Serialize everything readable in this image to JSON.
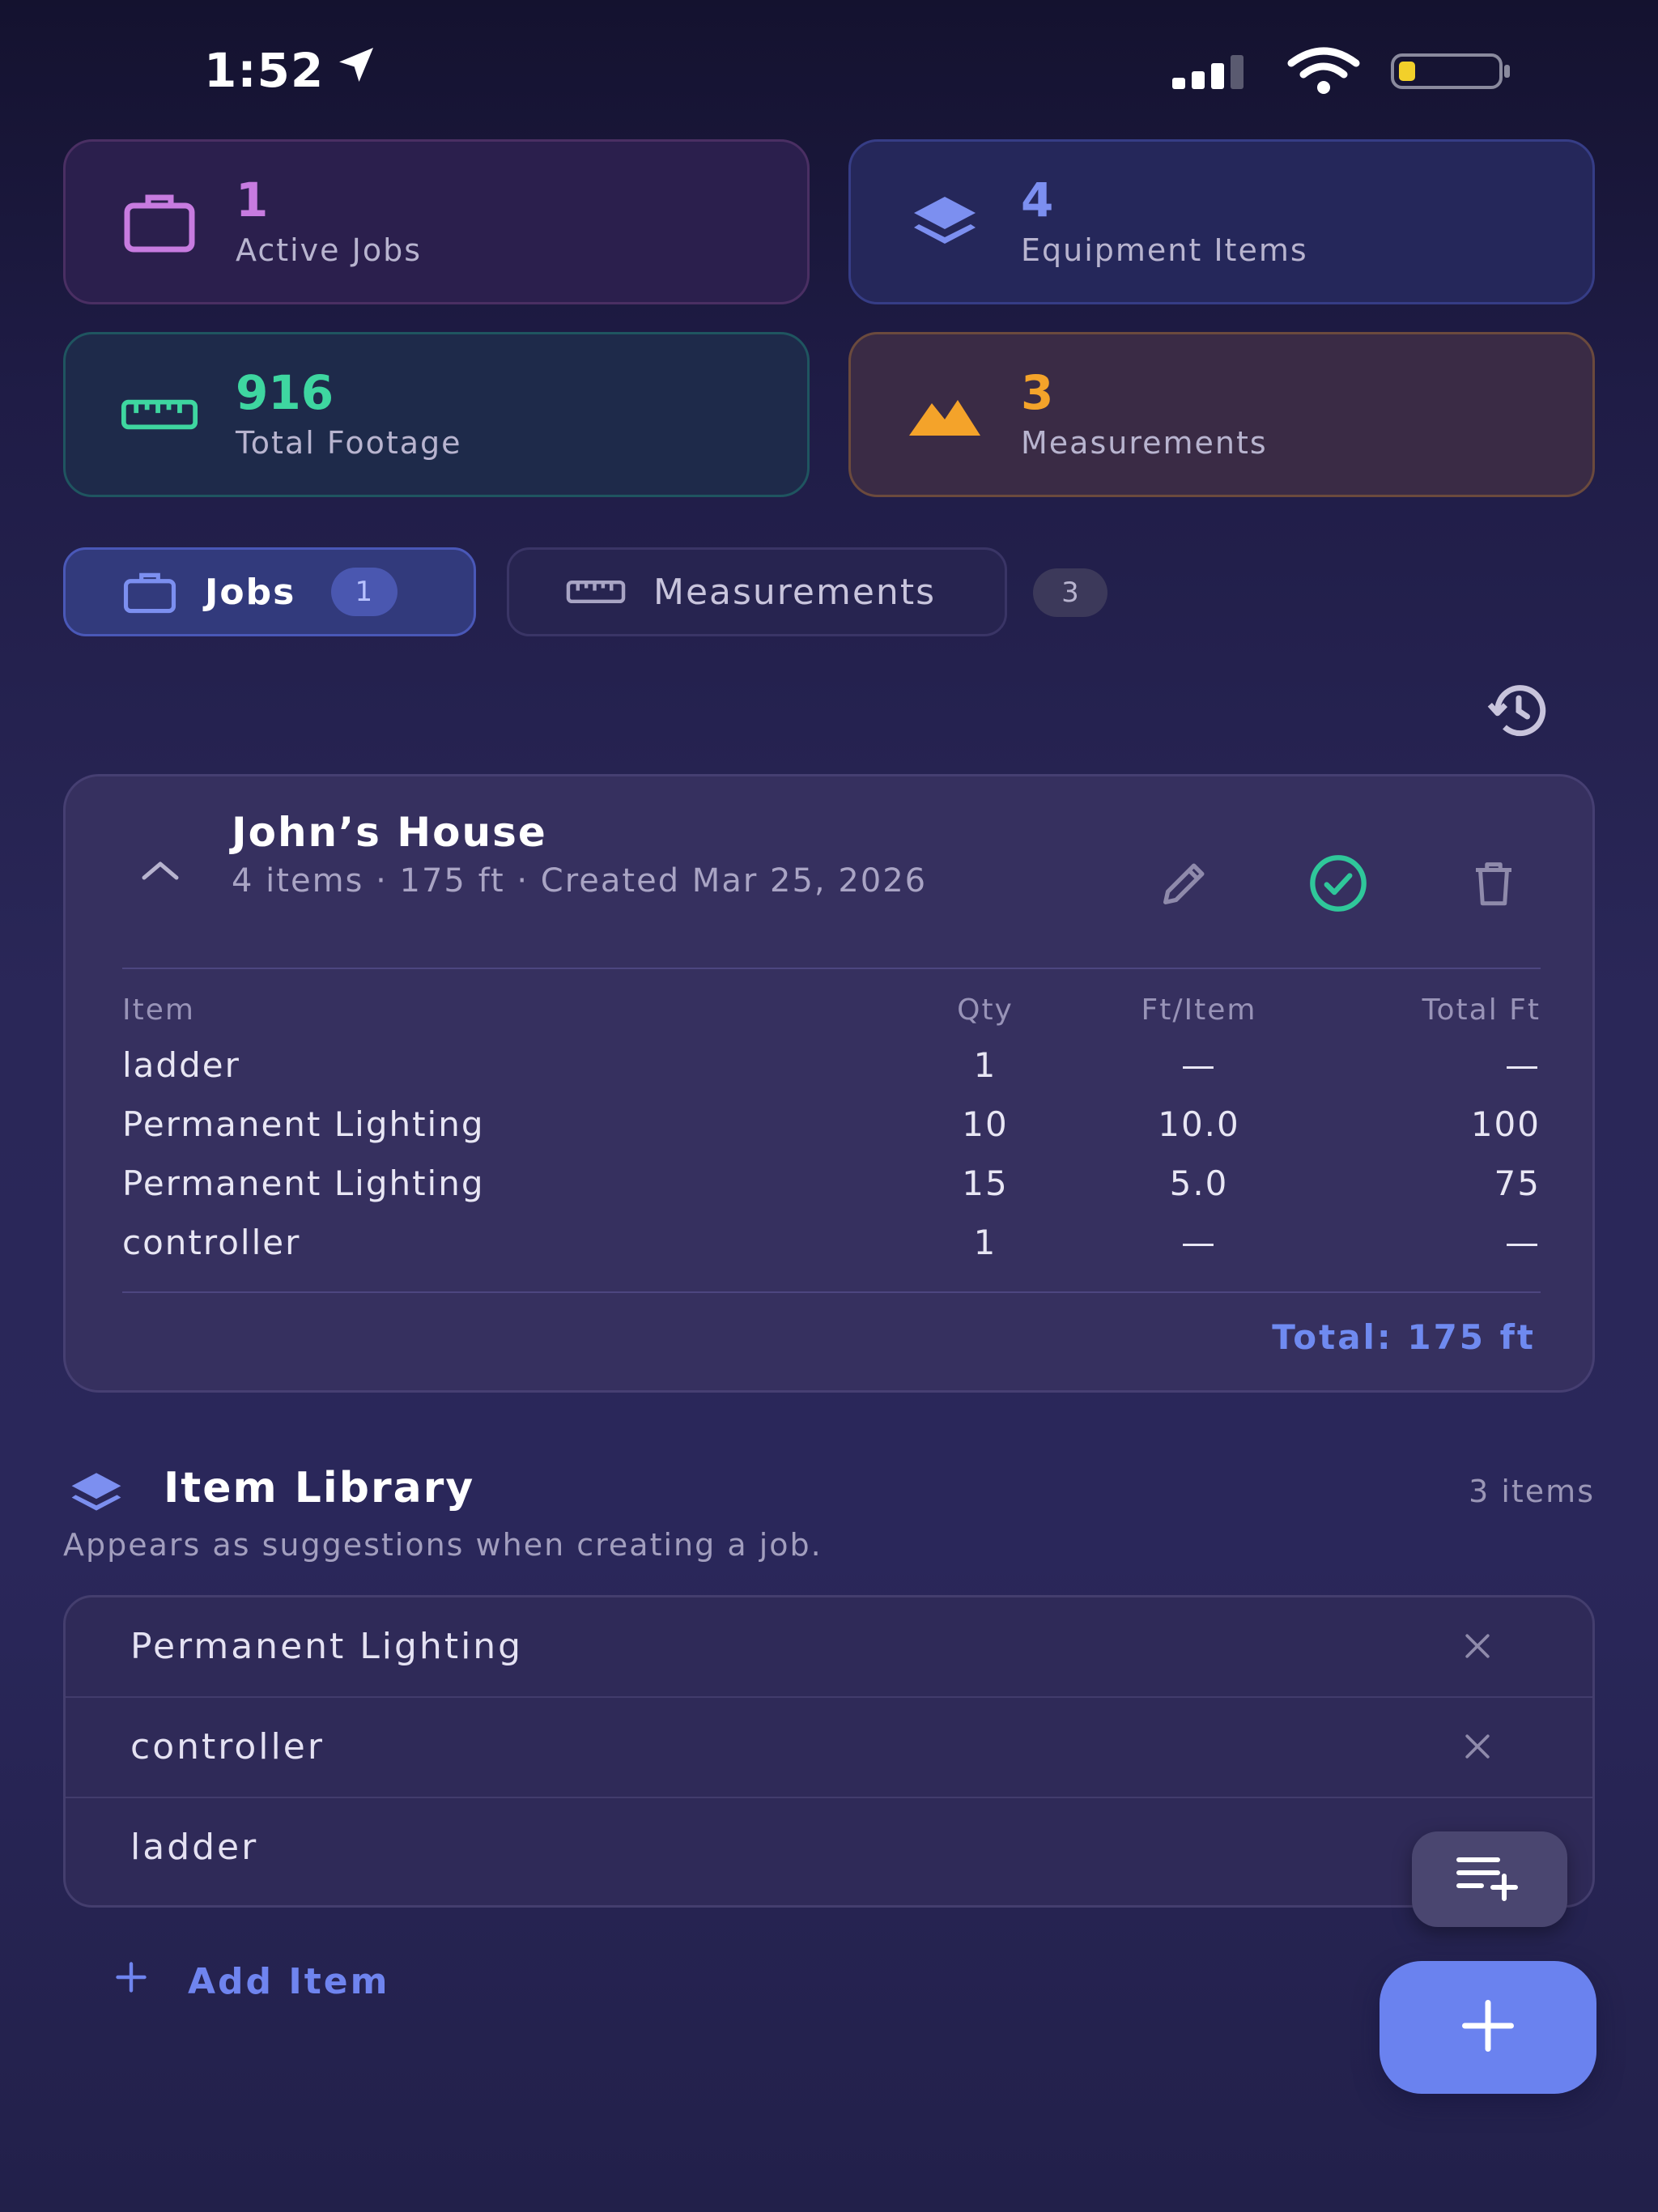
{
  "status_bar": {
    "time": "1:52"
  },
  "stats": [
    {
      "value": "1",
      "label": "Active Jobs",
      "icon": "briefcase-icon",
      "color": "#c77be0"
    },
    {
      "value": "4",
      "label": "Equipment Items",
      "icon": "layers-icon",
      "color": "#7c8ff0"
    },
    {
      "value": "916",
      "label": "Total Footage",
      "icon": "ruler-icon",
      "color": "#3ed6a0"
    },
    {
      "value": "3",
      "label": "Measurements",
      "icon": "mountain-icon",
      "color": "#f4a32a"
    }
  ],
  "tabs": [
    {
      "label": "Jobs",
      "count": "1",
      "icon": "briefcase-icon"
    },
    {
      "label": "Measurements",
      "count": "3",
      "icon": "ruler-icon"
    }
  ],
  "job": {
    "title": "John’s House",
    "subtitle": "4 items · 175 ft · Created Mar 25, 2026",
    "columns": [
      "Item",
      "Qty",
      "Ft/Item",
      "Total Ft"
    ],
    "rows": [
      {
        "item": "ladder",
        "qty": "1",
        "ft_item": "—",
        "total": "—"
      },
      {
        "item": "Permanent Lighting",
        "qty": "10",
        "ft_item": "10.0",
        "total": "100"
      },
      {
        "item": "Permanent Lighting",
        "qty": "15",
        "ft_item": "5.0",
        "total": "75"
      },
      {
        "item": "controller",
        "qty": "1",
        "ft_item": "—",
        "total": "—"
      }
    ],
    "total": "Total: 175 ft"
  },
  "library": {
    "title": "Item Library",
    "count": "3 items",
    "description": "Appears as suggestions when creating a job.",
    "items": [
      "Permanent Lighting",
      "controller",
      "ladder"
    ],
    "add_label": "Add Item"
  }
}
